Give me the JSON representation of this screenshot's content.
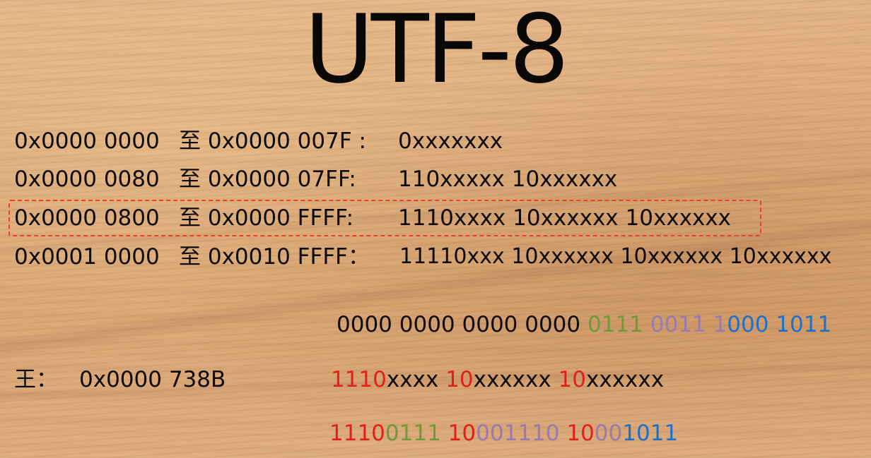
{
  "title": "UTF-8",
  "ranges": [
    {
      "from": "0x0000 0000",
      "sep": "至",
      "to": "0x0000 007F :",
      "pattern": "0xxxxxxx"
    },
    {
      "from": "0x0000 0080",
      "sep": "至",
      "to": "0x0000 07FF:",
      "pattern": "110xxxxx 10xxxxxx"
    },
    {
      "from": "0x0000 0800",
      "sep": "至",
      "to": "0x0000 FFFF:",
      "pattern": "1110xxxx 10xxxxxx 10xxxxxx"
    },
    {
      "from": "0x0001 0000",
      "sep": "至",
      "to": "0x0010 FFFF：",
      "pattern": "11110xxx 10xxxxxx 10xxxxxx 10xxxxxx"
    }
  ],
  "example": {
    "char": "王：",
    "codepoint": "0x0000 738B",
    "binary": {
      "prefix": "0000 0000 0000 0000 ",
      "g1": "0111",
      "g2": "0011",
      "g3a": "1",
      "g3b": "000",
      "g4": "1011"
    },
    "template": {
      "p1": "1110",
      "x1": "xxxx ",
      "p2": "10",
      "x2": "xxxxxx ",
      "p3": "10",
      "x3": "xxxxxx"
    },
    "encoded": {
      "b1_prefix": "1110",
      "b1_bits": "0111",
      "b2_prefix": "10",
      "b2_bits_a": "0011",
      "b2_bits_b": "10",
      "b3_prefix": "10",
      "b3_bits_a": "00",
      "b3_bits_b": "1011"
    }
  },
  "colors": {
    "prefix": "#e0201a",
    "group1": "#6f9a3a",
    "group2": "#9b7ab0",
    "group3": "#1f70c8",
    "highlight_border": "#e8432a"
  }
}
